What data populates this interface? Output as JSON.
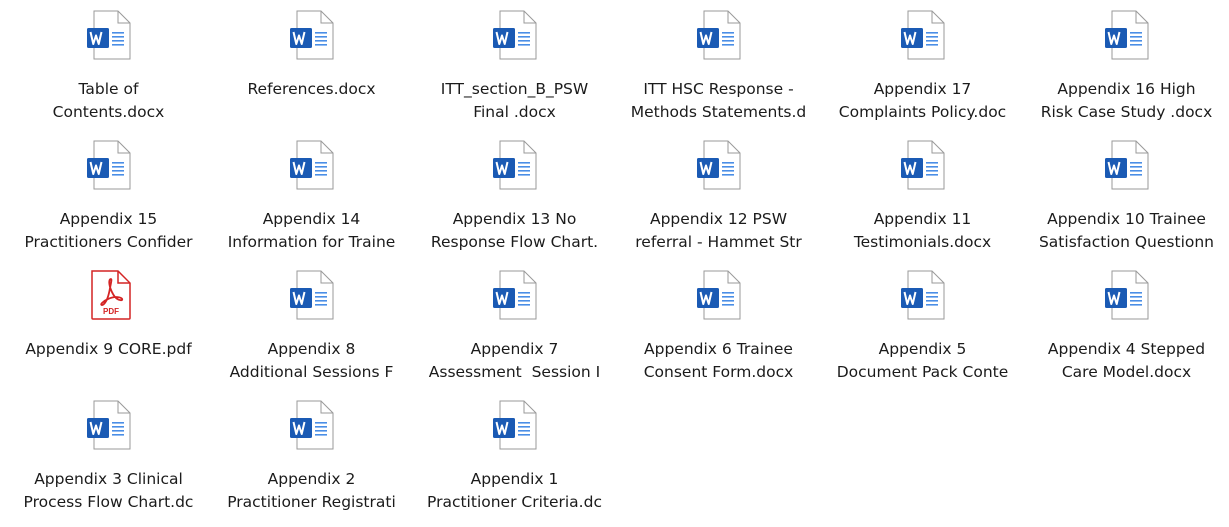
{
  "colors": {
    "word_blue": "#1a5ab4",
    "word_blue_light": "#4a8ee6",
    "pdf_red": "#d42424",
    "page_fill": "#ffffff",
    "page_stroke": "#9a9a9a"
  },
  "files": [
    {
      "icon": "word-doc-icon",
      "line1": "Table of",
      "line2": "Contents.docx"
    },
    {
      "icon": "word-doc-icon",
      "line1": "References.docx",
      "line2": ""
    },
    {
      "icon": "word-doc-icon",
      "line1": "ITT_section_B_PSW",
      "line2": "Final .docx"
    },
    {
      "icon": "word-doc-icon",
      "line1": "ITT HSC Response -",
      "line2": "Methods Statements.d"
    },
    {
      "icon": "word-doc-icon",
      "line1": "Appendix 17",
      "line2": "Complaints Policy.doc"
    },
    {
      "icon": "word-doc-icon",
      "line1": "Appendix 16 High",
      "line2": "Risk Case Study .docx"
    },
    {
      "icon": "word-doc-icon",
      "line1": "Appendix 15",
      "line2": "Practitioners Confider"
    },
    {
      "icon": "word-doc-icon",
      "line1": "Appendix 14",
      "line2": "Information for Traine"
    },
    {
      "icon": "word-doc-icon",
      "line1": "Appendix 13 No",
      "line2": "Response Flow Chart."
    },
    {
      "icon": "word-doc-icon",
      "line1": "Appendix 12 PSW",
      "line2": "referral - Hammet Str"
    },
    {
      "icon": "word-doc-icon",
      "line1": "Appendix 11",
      "line2": "Testimonials.docx"
    },
    {
      "icon": "word-doc-icon",
      "line1": "Appendix 10 Trainee",
      "line2": "Satisfaction Questionn"
    },
    {
      "icon": "pdf-doc-icon",
      "line1": "Appendix 9 CORE.pdf",
      "line2": "",
      "badge": "PDF"
    },
    {
      "icon": "word-doc-icon",
      "line1": "Appendix 8",
      "line2": "Additional Sessions F"
    },
    {
      "icon": "word-doc-icon",
      "line1": "Appendix 7",
      "line2": "Assessment  Session I"
    },
    {
      "icon": "word-doc-icon",
      "line1": "Appendix 6 Trainee",
      "line2": "Consent Form.docx"
    },
    {
      "icon": "word-doc-icon",
      "line1": "Appendix 5",
      "line2": "Document Pack Conte"
    },
    {
      "icon": "word-doc-icon",
      "line1": "Appendix 4 Stepped",
      "line2": "Care Model.docx"
    },
    {
      "icon": "word-doc-icon",
      "line1": "Appendix 3 Clinical",
      "line2": "Process Flow Chart.dc"
    },
    {
      "icon": "word-doc-icon",
      "line1": "Appendix 2",
      "line2": "Practitioner Registrati"
    },
    {
      "icon": "word-doc-icon",
      "line1": "Appendix 1",
      "line2": "Practitioner Criteria.dc"
    }
  ]
}
